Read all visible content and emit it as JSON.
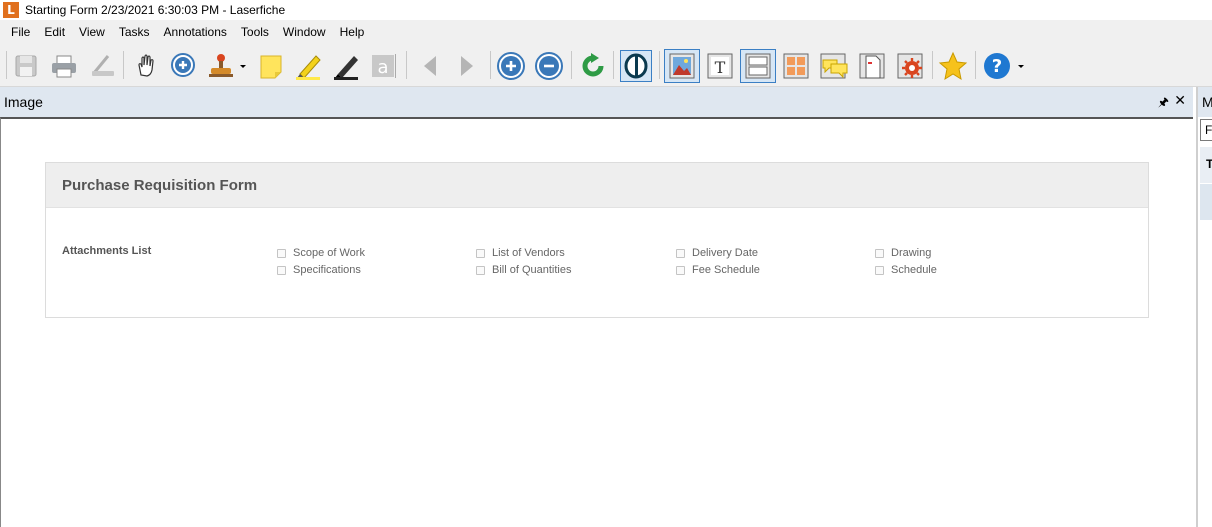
{
  "window": {
    "title": "Starting Form 2/23/2021 6:30:03 PM - Laserfiche",
    "logo_letter": "L"
  },
  "menu": [
    "File",
    "Edit",
    "View",
    "Tasks",
    "Annotations",
    "Tools",
    "Window",
    "Help"
  ],
  "toolbar_icons": [
    "save-icon",
    "print-icon",
    "scanner-icon",
    "hand-icon",
    "zoom-in-icon",
    "stamp-icon",
    "sticky-note-icon",
    "highlighter-icon",
    "marker-icon",
    "text-annotation-icon",
    "previous-page-icon",
    "next-page-icon",
    "add-icon",
    "remove-icon",
    "refresh-icon",
    "ocr-icon",
    "image-view-icon",
    "text-view-icon",
    "split-view-icon",
    "thumbnails-icon",
    "comments-icon",
    "document-icon",
    "settings-icon",
    "favorite-icon",
    "help-icon"
  ],
  "pane": {
    "title": "Image",
    "pin": "🖈",
    "close": "✕"
  },
  "form": {
    "title": "Purchase Requisition Form",
    "attachments_label": "Attachments List",
    "options": [
      {
        "label": "Scope of Work",
        "checked": false
      },
      {
        "label": "Specifications",
        "checked": false
      },
      {
        "label": "List of Vendors",
        "checked": false
      },
      {
        "label": "Bill of Quantities",
        "checked": false
      },
      {
        "label": "Delivery Date",
        "checked": false
      },
      {
        "label": "Fee Schedule",
        "checked": false
      },
      {
        "label": "Drawing",
        "checked": false
      },
      {
        "label": "Schedule",
        "checked": false
      }
    ]
  },
  "right_panel": {
    "header": "M",
    "input": "Fi",
    "row": "T"
  },
  "colors": {
    "brand": "#e0701e",
    "pane_header": "#dfe7f0",
    "toolbar": "#f0f0f0",
    "selected": "#3b7fc4"
  }
}
